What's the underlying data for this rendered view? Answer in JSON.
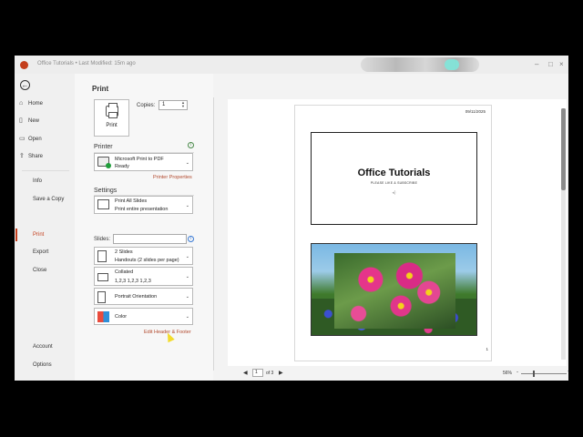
{
  "window": {
    "title": "Office Tutorials • Last Modified: 15m ago"
  },
  "nav": {
    "back_icon": "arrow-left-icon",
    "items": [
      {
        "label": "Home",
        "icon": "home-icon"
      },
      {
        "label": "New",
        "icon": "new-doc-icon"
      },
      {
        "label": "Open",
        "icon": "folder-icon"
      },
      {
        "label": "Share",
        "icon": "share-icon"
      },
      {
        "label": "Info"
      },
      {
        "label": "Save a Copy"
      },
      {
        "label": "Print"
      },
      {
        "label": "Export"
      },
      {
        "label": "Close"
      },
      {
        "label": "Account"
      },
      {
        "label": "Options"
      }
    ],
    "active": "Print",
    "accent_color": "#c43e1c"
  },
  "print": {
    "heading": "Print",
    "print_button_label": "Print",
    "copies_label": "Copies:",
    "copies_value": "1",
    "printer_heading": "Printer",
    "printer_name": "Microsoft Print to PDF",
    "printer_status": "Ready",
    "printer_properties_link": "Printer Properties",
    "settings_heading": "Settings",
    "setting_slides_range": "Print All Slides",
    "setting_slides_range_sub": "Print entire presentation",
    "slides_label": "Slides:",
    "slides_value": "",
    "setting_layout": "2 Slides",
    "setting_layout_sub": "Handouts (2 slides per page)",
    "setting_collate": "Collated",
    "setting_collate_sub": "1,2,3     1,2,3     1,2,3",
    "setting_orientation": "Portrait Orientation",
    "setting_color": "Color",
    "header_footer_link": "Edit Header & Footer"
  },
  "preview": {
    "date": "09/11/2025",
    "slide1_title": "Office Tutorials",
    "slide1_subtitle": "PLEASE LIKE & SUBSCRIBE",
    "page_number": "1",
    "current_page": "1",
    "total_pages_text": "of 3",
    "zoom_text": "56%"
  }
}
